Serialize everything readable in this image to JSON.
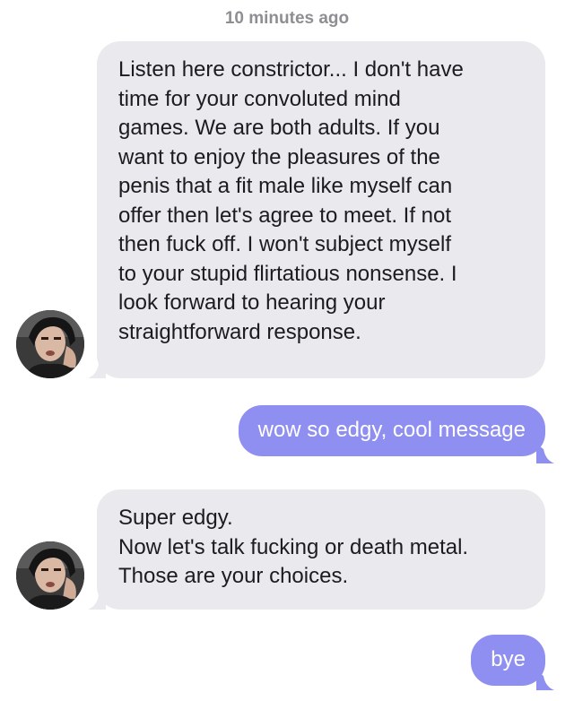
{
  "timestamp": "10 minutes ago",
  "colors": {
    "incoming_bubble": "#e9e9ee",
    "outgoing_bubble": "#8f8ff2",
    "timestamp": "#8e8e93"
  },
  "messages": [
    {
      "direction": "incoming",
      "lines": [
        "Listen here constrictor... I don't have",
        "time for your convoluted mind",
        "games. We are both adults. If you",
        "want to enjoy the pleasures of the",
        "penis that a fit male like myself can",
        "offer then let's agree to meet. If not",
        "then fuck off. I won't subject myself",
        "to your stupid flirtatious nonsense. I",
        "look forward to hearing your",
        "straightforward response."
      ]
    },
    {
      "direction": "outgoing",
      "lines": [
        "wow so edgy, cool message"
      ]
    },
    {
      "direction": "incoming",
      "lines": [
        "Super edgy.",
        "Now let's talk fucking or death metal.",
        "Those are your choices."
      ]
    },
    {
      "direction": "outgoing",
      "lines": [
        "bye"
      ]
    }
  ]
}
